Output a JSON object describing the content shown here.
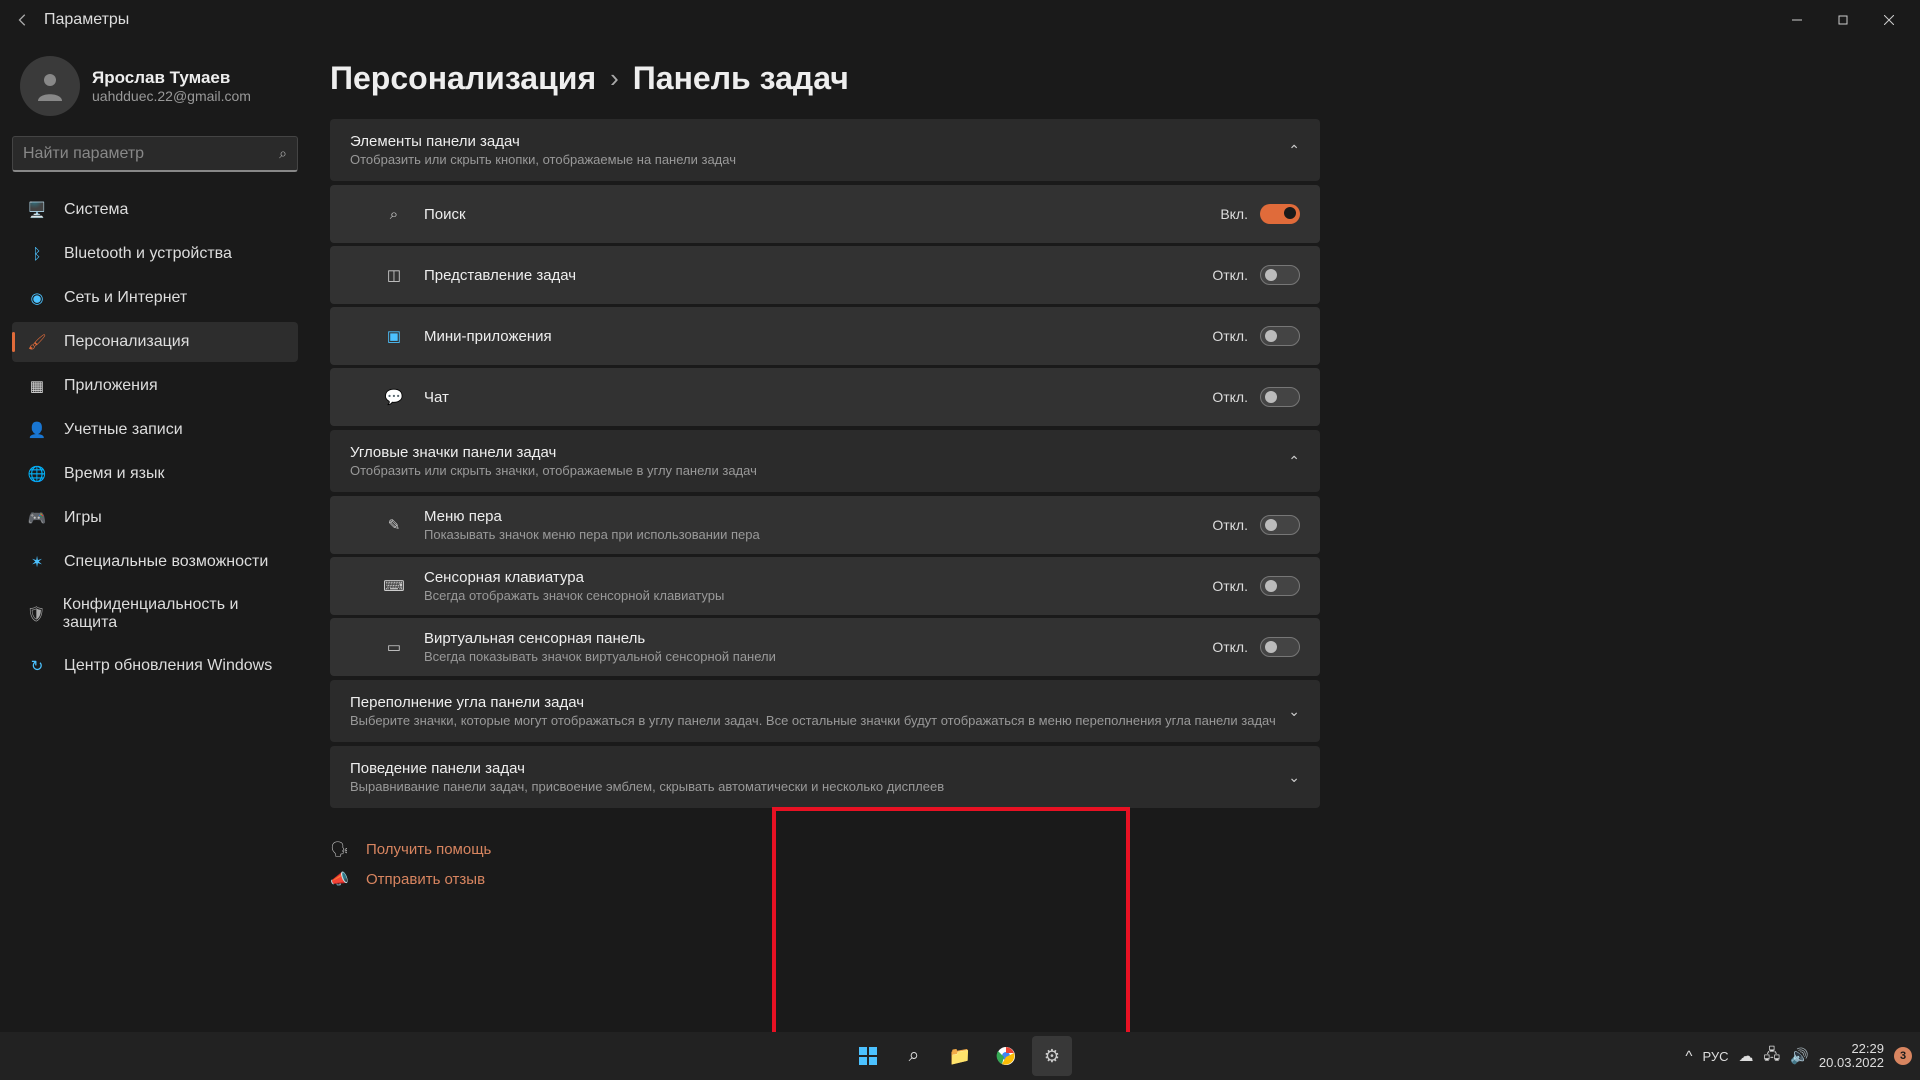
{
  "window": {
    "title": "Параметры"
  },
  "user": {
    "name": "Ярослав Тумаев",
    "email": "uahdduec.22@gmail.com"
  },
  "search": {
    "placeholder": "Найти параметр"
  },
  "nav": {
    "items": [
      {
        "label": "Система"
      },
      {
        "label": "Bluetooth и устройства"
      },
      {
        "label": "Сеть и Интернет"
      },
      {
        "label": "Персонализация"
      },
      {
        "label": "Приложения"
      },
      {
        "label": "Учетные записи"
      },
      {
        "label": "Время и язык"
      },
      {
        "label": "Игры"
      },
      {
        "label": "Специальные возможности"
      },
      {
        "label": "Конфиденциальность и защита"
      },
      {
        "label": "Центр обновления Windows"
      }
    ]
  },
  "breadcrumb": {
    "parent": "Персонализация",
    "current": "Панель задач"
  },
  "section1": {
    "title": "Элементы панели задач",
    "desc": "Отобразить или скрыть кнопки, отображаемые на панели задач",
    "items": [
      {
        "title": "Поиск",
        "state": "Вкл.",
        "on": true
      },
      {
        "title": "Представление задач",
        "state": "Откл.",
        "on": false
      },
      {
        "title": "Мини-приложения",
        "state": "Откл.",
        "on": false
      },
      {
        "title": "Чат",
        "state": "Откл.",
        "on": false
      }
    ]
  },
  "section2": {
    "title": "Угловые значки панели задач",
    "desc": "Отобразить или скрыть значки, отображаемые в углу панели задач",
    "items": [
      {
        "title": "Меню пера",
        "desc": "Показывать значок меню пера при использовании пера",
        "state": "Откл.",
        "on": false
      },
      {
        "title": "Сенсорная клавиатура",
        "desc": "Всегда отображать значок сенсорной клавиатуры",
        "state": "Откл.",
        "on": false
      },
      {
        "title": "Виртуальная сенсорная панель",
        "desc": "Всегда показывать значок виртуальной сенсорной панели",
        "state": "Откл.",
        "on": false
      }
    ]
  },
  "section3": {
    "title": "Переполнение угла панели задач",
    "desc": "Выберите значки, которые могут отображаться в углу панели задач. Все остальные значки будут отображаться в меню переполнения угла панели задач"
  },
  "section4": {
    "title": "Поведение панели задач",
    "desc": "Выравнивание панели задач, присвоение эмблем, скрывать автоматически и несколько дисплеев"
  },
  "help": {
    "get_help": "Получить помощь",
    "feedback": "Отправить отзыв"
  },
  "taskbar": {
    "lang": "РУС",
    "time": "22:29",
    "date": "20.03.2022",
    "notif_count": "3"
  }
}
